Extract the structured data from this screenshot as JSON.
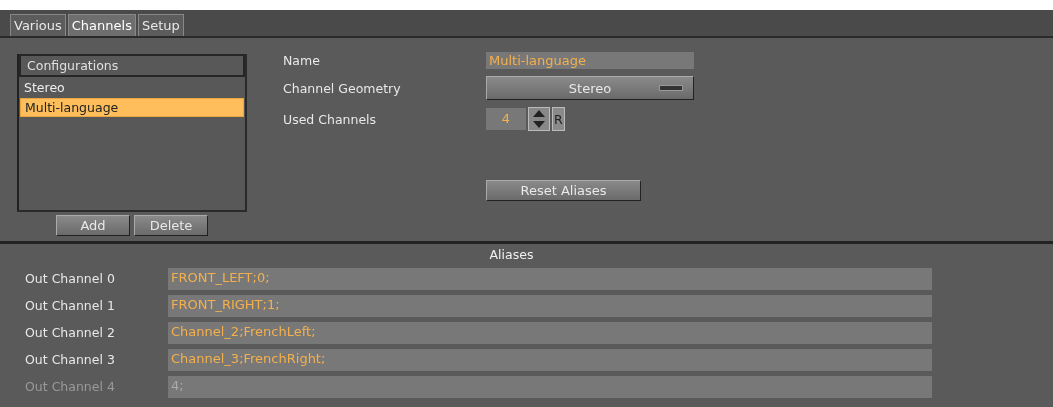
{
  "tabs": [
    {
      "label": "Various",
      "selected": false
    },
    {
      "label": "Channels",
      "selected": true
    },
    {
      "label": "Setup",
      "selected": false
    }
  ],
  "configurations": {
    "header": "Configurations",
    "items": [
      {
        "label": "Stereo",
        "selected": false
      },
      {
        "label": "Multi-language",
        "selected": true
      }
    ],
    "buttons": [
      "Add",
      "Delete"
    ]
  },
  "form": {
    "name_label": "Name",
    "name_value": "Multi-language",
    "geometry_label": "Channel Geometry",
    "geometry_value": "Stereo",
    "used_label": "Used Channels",
    "used_value": "4",
    "reset_key": "R",
    "reset_button": "Reset Aliases"
  },
  "aliases": {
    "title": "Aliases",
    "rows": [
      {
        "label": "Out Channel 0",
        "value": "FRONT_LEFT;0;",
        "disabled": false
      },
      {
        "label": "Out Channel 1",
        "value": "FRONT_RIGHT;1;",
        "disabled": false
      },
      {
        "label": "Out Channel 2",
        "value": "Channel_2;FrenchLeft;",
        "disabled": false
      },
      {
        "label": "Out Channel 3",
        "value": "Channel_3;FrenchRight;",
        "disabled": false
      },
      {
        "label": "Out Channel 4",
        "value": "4;",
        "disabled": true
      }
    ]
  }
}
